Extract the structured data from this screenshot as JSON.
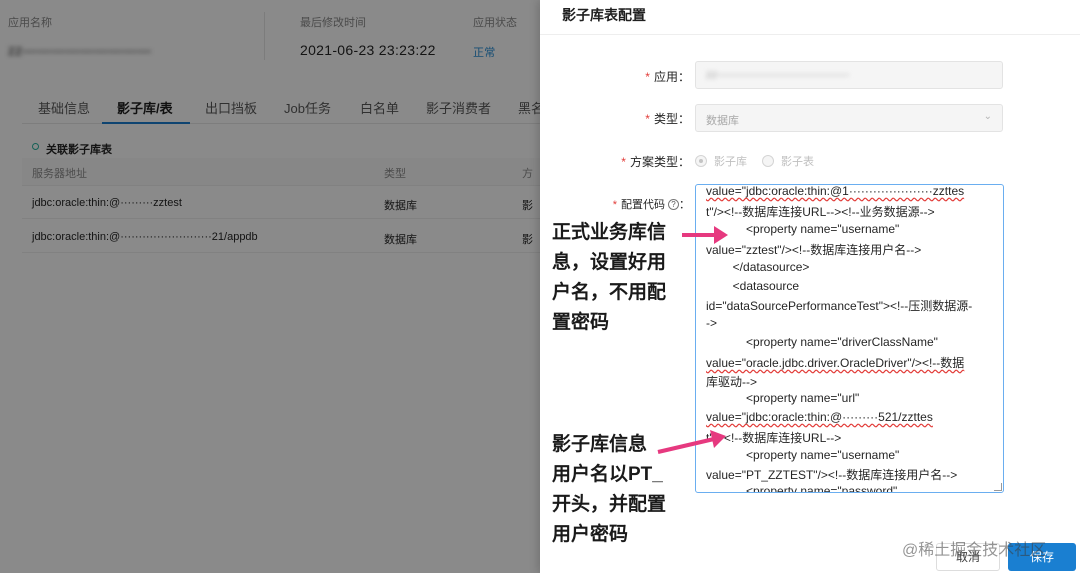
{
  "app": {
    "name_label": "应用名称",
    "name_value": "zz—————————",
    "modified_label": "最后修改时间",
    "modified_value": "2021-06-23 23:23:22",
    "status_label": "应用状态",
    "status_value": "正常"
  },
  "tabs": [
    {
      "label": "基础信息"
    },
    {
      "label": "影子库/表"
    },
    {
      "label": "出口挡板"
    },
    {
      "label": "Job任务"
    },
    {
      "label": "白名单"
    },
    {
      "label": "影子消费者"
    },
    {
      "label": "黑名"
    }
  ],
  "section_title": "关联影子库表",
  "table": {
    "headers": [
      "服务器地址",
      "类型",
      "方"
    ],
    "rows": [
      [
        "jdbc:oracle:thin:@·········zztest",
        "数据库",
        "影"
      ],
      [
        "jdbc:oracle:thin:@·························21/appdb",
        "数据库",
        "影"
      ]
    ]
  },
  "drawer": {
    "title": "影子库表配置",
    "app_label": "应用",
    "app_value": "zz————————————",
    "type_label": "类型",
    "type_value": "数据库",
    "scheme_label": "方案类型",
    "scheme_options": [
      "影子库",
      "影子表"
    ],
    "code_label": "配置代码",
    "code_lines": [
      "value=\"jdbc:oracle:thin:@1·····················zzttes",
      "t\"/><!--数据库连接URL--><!--业务数据源-->",
      "            <property name=\"username\"",
      "value=\"zztest\"/><!--数据库连接用户名-->",
      "        </datasource>",
      "        <datasource",
      "id=\"dataSourcePerformanceTest\"><!--压测数据源-",
      "->",
      "            <property name=\"driverClassName\"",
      "value=\"oracle.jdbc.driver.OracleDriver\"/><!--数据",
      "库驱动-->",
      "            <property name=\"url\"",
      "value=\"jdbc:oracle:thin:@·········521/zzttes",
      "t\"/><!--数据库连接URL-->",
      "            <property name=\"username\"",
      "value=\"PT_ZZTEST\"/><!--数据库连接用户名-->",
      "            <property name=\"password\""
    ]
  },
  "annotations": {
    "top": [
      "正式业务库信",
      "息，设置好用",
      "户名，不用配",
      "置密码"
    ],
    "bottom": [
      "影子库信息",
      "用户名以PT_",
      "开头，并配置",
      "用户密码"
    ]
  },
  "buttons": {
    "cancel": "取消",
    "confirm": "保存"
  },
  "watermark": "@稀土掘金技术社区"
}
